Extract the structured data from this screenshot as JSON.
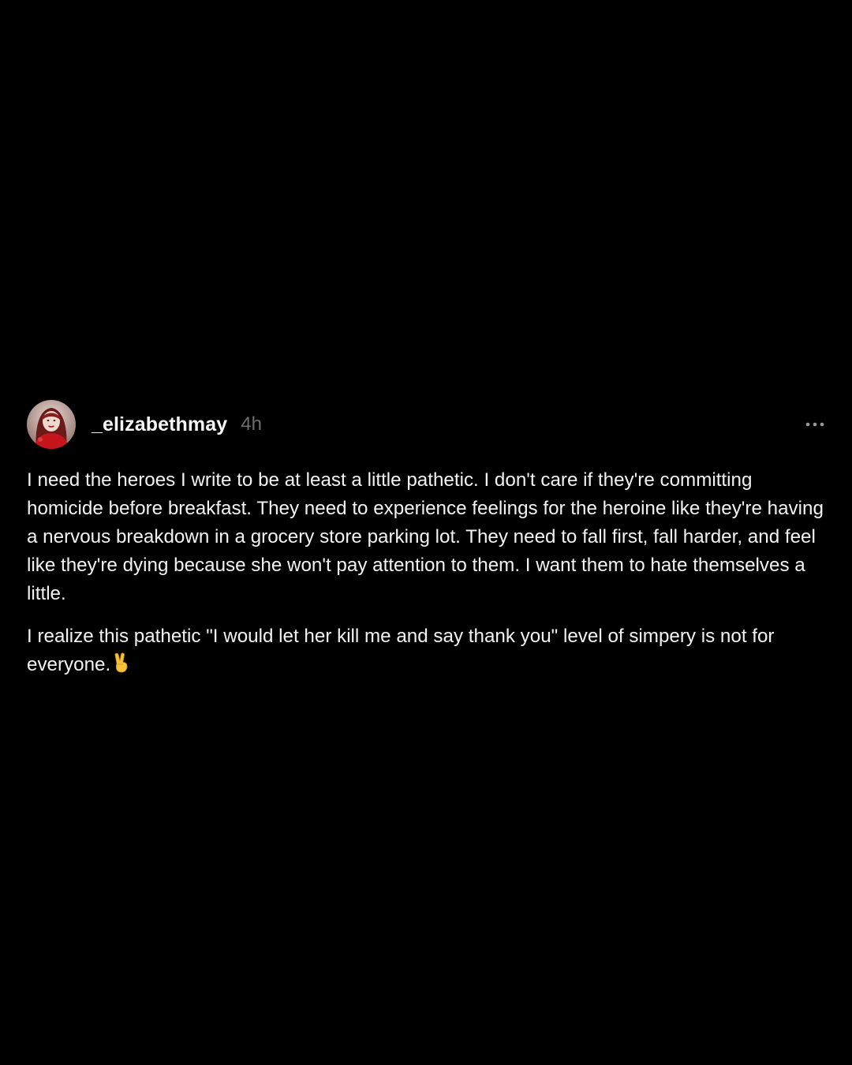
{
  "post": {
    "author": {
      "username": "_elizabethmay",
      "avatar_icon": "profile-photo"
    },
    "timestamp": "4h",
    "more_icon": "more-horizontal-icon",
    "paragraphs": [
      "I need the heroes I write to be at least a little pathetic. I don't care if they're committing homicide before breakfast. They need to experience feelings for the heroine like they're having a nervous breakdown in a grocery store parking lot. They need to fall first, fall harder, and feel like they're dying because she won't pay attention to them. I want them to hate themselves a little.",
      "I realize this pathetic \"I would let her kill me and say thank you\" level of simpery is not for everyone."
    ],
    "emoji_icon": "victory-hand-emoji"
  },
  "colors": {
    "background": "#000000",
    "text": "#f2f2f2",
    "muted": "#6e6e6e",
    "avatar_accent": "#c4161c"
  }
}
